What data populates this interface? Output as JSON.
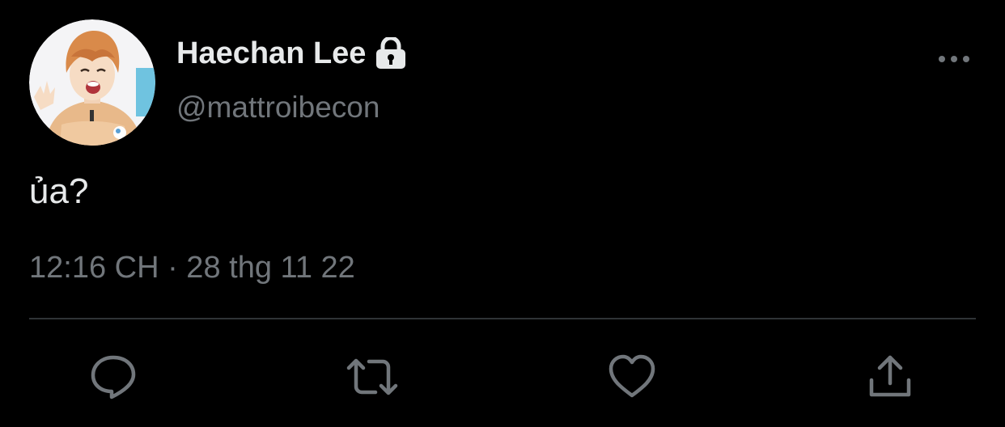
{
  "tweet": {
    "author": {
      "display_name": "Haechan Lee",
      "handle": "@mattroibecon",
      "protected_icon": "lock-icon",
      "avatar": "avatar"
    },
    "text": "ủa?",
    "timestamp": "12:16 CH · 28 thg 11 22",
    "more_icon": "more-horizontal-icon"
  },
  "actions": [
    {
      "name": "reply",
      "icon": "reply-icon"
    },
    {
      "name": "retweet",
      "icon": "retweet-icon"
    },
    {
      "name": "like",
      "icon": "heart-icon"
    },
    {
      "name": "share",
      "icon": "share-icon"
    }
  ],
  "colors": {
    "background": "#000000",
    "primary_text": "#e7e9ea",
    "secondary_text": "#71767b",
    "divider": "#2f3336",
    "icon": "#71767b"
  }
}
